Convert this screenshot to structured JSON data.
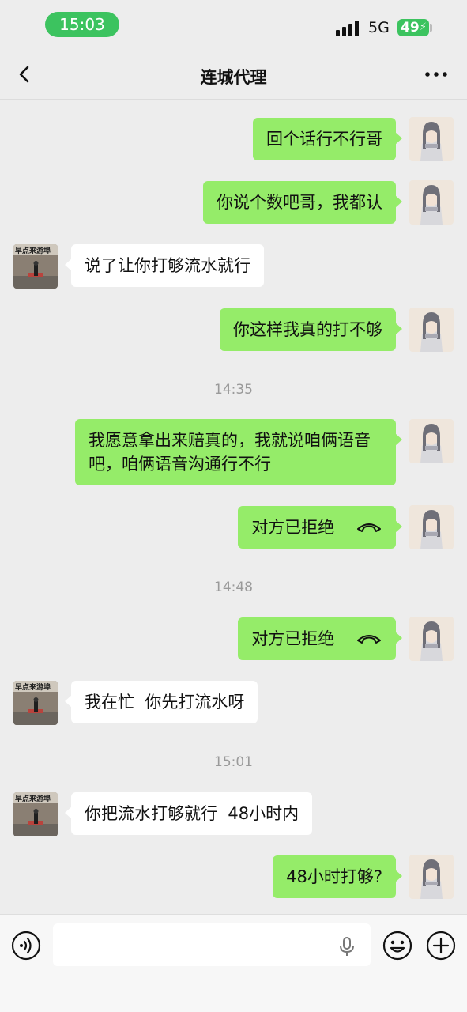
{
  "status_bar": {
    "time": "15:03",
    "network": "5G",
    "battery": "49",
    "accent_color": "#3cc35f"
  },
  "nav": {
    "title": "连城代理",
    "back_icon": "chevron-left-icon",
    "more_icon": "more-horizontal-icon"
  },
  "messages": [
    {
      "from": "self",
      "text": "回个话行不行哥"
    },
    {
      "from": "self",
      "text": "你说个数吧哥，我都认"
    },
    {
      "from": "other",
      "text": "说了让你打够流水就行"
    },
    {
      "from": "self",
      "text": "你这样我真的打不够"
    },
    {
      "timestamp": "14:35"
    },
    {
      "from": "self",
      "text": "我愿意拿出来赔真的，我就说咱俩语音吧，咱俩语音沟通行不行"
    },
    {
      "from": "self",
      "text": "对方已拒绝",
      "call_icon": "call-declined-icon"
    },
    {
      "timestamp": "14:48"
    },
    {
      "from": "self",
      "text": "对方已拒绝",
      "call_icon": "call-declined-icon"
    },
    {
      "from": "other",
      "text": "我在忙  你先打流水呀"
    },
    {
      "timestamp": "15:01"
    },
    {
      "from": "other",
      "text": "你把流水打够就行  48小时内"
    },
    {
      "from": "self",
      "text": "48小时打够?"
    }
  ],
  "input_bar": {
    "value": "",
    "voice_icon": "voice-icon",
    "mic_icon": "microphone-icon",
    "emoji_icon": "emoji-icon",
    "plus_icon": "plus-icon"
  },
  "colors": {
    "self_bubble": "#95ec69",
    "other_bubble": "#ffffff",
    "background": "#ededed",
    "timestamp_text": "#9a9a9a"
  }
}
